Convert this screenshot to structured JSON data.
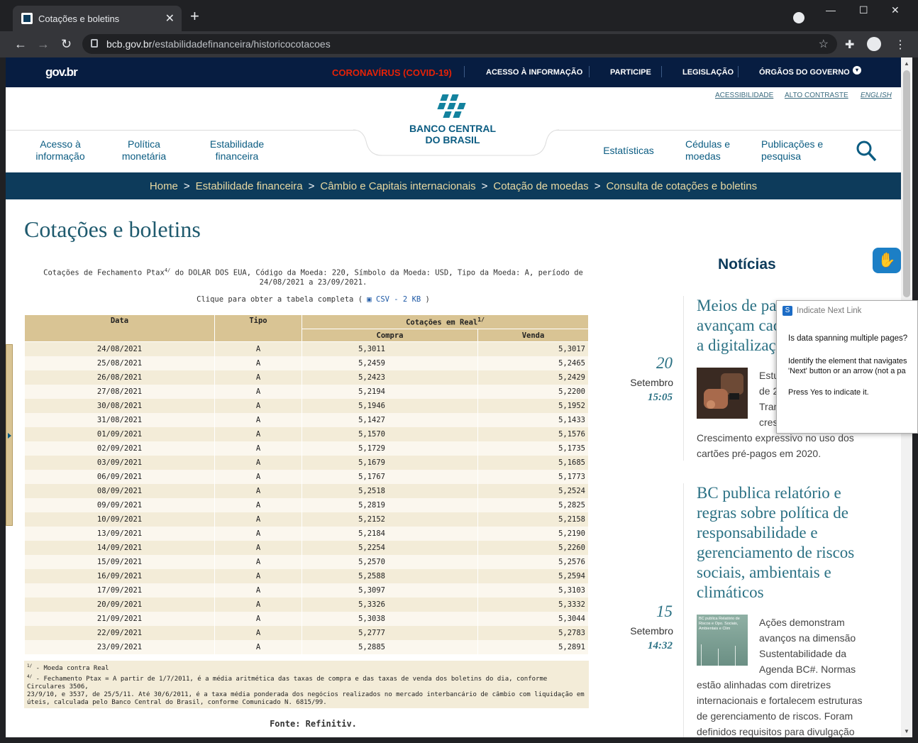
{
  "browser": {
    "tab_title": "Cotações e boletins",
    "url_host": "bcb.gov.br",
    "url_path": "/estabilidadefinanceira/historicocotacoes"
  },
  "gov_bar": {
    "logo": "gov.br",
    "covid": "CORONAVÍRUS (COVID-19)",
    "items": [
      "ACESSO À INFORMAÇÃO",
      "PARTICIPE",
      "LEGISLAÇÃO",
      "ÓRGÃOS DO GOVERNO"
    ]
  },
  "accessibility": [
    "ACESSIBILIDADE",
    "ALTO CONTRASTE",
    "ENGLISH"
  ],
  "bcb": {
    "line1": "BANCO CENTRAL",
    "line2": "DO BRASIL"
  },
  "menu": {
    "left": [
      [
        "Acesso à",
        "informação"
      ],
      [
        "Política",
        "monetária"
      ],
      [
        "Estabilidade",
        "financeira"
      ]
    ],
    "right": [
      [
        "Estatísticas",
        ""
      ],
      [
        "Cédulas e",
        "moedas"
      ],
      [
        "Publicações e",
        "pesquisa"
      ]
    ]
  },
  "breadcrumb": [
    "Home",
    "Estabilidade financeira",
    "Câmbio e Capitais internacionais",
    "Cotação de moedas",
    "Consulta de cotações e boletins"
  ],
  "page_title": "Cotações e boletins",
  "caption": {
    "pre": "Cotações de Fechamento Ptax",
    "sup": "4/",
    "post": " do DOLAR DOS EUA, Código da Moeda: 220, Símbolo da Moeda: USD, Tipo da Moeda: A, período de",
    "line2": "24/08/2021 a 23/09/2021."
  },
  "csv": {
    "pre": "Clique para obter a tabela completa ( ",
    "link": "CSV - 2 KB",
    "post": " )"
  },
  "table": {
    "headers": {
      "data": "Data",
      "tipo": "Tipo",
      "cotacoes": "Cotações em Real",
      "cotacoes_sup": "1/",
      "compra": "Compra",
      "venda": "Venda"
    },
    "rows": [
      [
        "24/08/2021",
        "A",
        "5,3011",
        "5,3017"
      ],
      [
        "25/08/2021",
        "A",
        "5,2459",
        "5,2465"
      ],
      [
        "26/08/2021",
        "A",
        "5,2423",
        "5,2429"
      ],
      [
        "27/08/2021",
        "A",
        "5,2194",
        "5,2200"
      ],
      [
        "30/08/2021",
        "A",
        "5,1946",
        "5,1952"
      ],
      [
        "31/08/2021",
        "A",
        "5,1427",
        "5,1433"
      ],
      [
        "01/09/2021",
        "A",
        "5,1570",
        "5,1576"
      ],
      [
        "02/09/2021",
        "A",
        "5,1729",
        "5,1735"
      ],
      [
        "03/09/2021",
        "A",
        "5,1679",
        "5,1685"
      ],
      [
        "06/09/2021",
        "A",
        "5,1767",
        "5,1773"
      ],
      [
        "08/09/2021",
        "A",
        "5,2518",
        "5,2524"
      ],
      [
        "09/09/2021",
        "A",
        "5,2819",
        "5,2825"
      ],
      [
        "10/09/2021",
        "A",
        "5,2152",
        "5,2158"
      ],
      [
        "13/09/2021",
        "A",
        "5,2184",
        "5,2190"
      ],
      [
        "14/09/2021",
        "A",
        "5,2254",
        "5,2260"
      ],
      [
        "15/09/2021",
        "A",
        "5,2570",
        "5,2576"
      ],
      [
        "16/09/2021",
        "A",
        "5,2588",
        "5,2594"
      ],
      [
        "17/09/2021",
        "A",
        "5,3097",
        "5,3103"
      ],
      [
        "20/09/2021",
        "A",
        "5,3326",
        "5,3332"
      ],
      [
        "21/09/2021",
        "A",
        "5,3038",
        "5,3044"
      ],
      [
        "22/09/2021",
        "A",
        "5,2777",
        "5,2783"
      ],
      [
        "23/09/2021",
        "A",
        "5,2885",
        "5,2891"
      ]
    ]
  },
  "notes": {
    "n1_sup": "1/",
    "n1": " - Moeda contra Real",
    "n4_sup": "4/",
    "n4_l1": " - Fechamento Ptax = A partir de 1/7/2011, é a média aritmética das taxas de compra e das taxas de venda dos boletins do dia, conforme Circulares 3506,",
    "n4_l2": "23/9/10, e 3537, de 25/5/11. Até 30/6/2011, é a taxa média ponderada dos negócios realizados no mercado interbancário de câmbio com liquidação em doi",
    "n4_l3": "úteis, calculada pelo Banco Central do Brasil, conforme Comunicado N. 6815/99."
  },
  "fonte": "Fonte: Refinitiv.",
  "news": {
    "heading": "Notícias",
    "items": [
      {
        "title": [
          "Meios de pa",
          "avançam cad",
          "a digitalizaç"
        ],
        "day": "20",
        "month": "Setembro",
        "time": "15:05",
        "text": [
          "Estu",
          "de 2",
          "Tran",
          "cres",
          "Crescimento expressivo no uso dos",
          "cartões pré-pagos em 2020."
        ]
      },
      {
        "title": [
          "BC publica relatório e",
          "regras sobre política de",
          "responsabilidade e",
          "gerenciamento de riscos",
          "sociais, ambientais e",
          "climáticos"
        ],
        "day": "15",
        "month": "Setembro",
        "time": "14:32",
        "thumb_caption": "BC publica Relatório de Riscos e Opo. Sociais, Ambientais e Clim",
        "text": [
          "Ações demonstram",
          "avanços na dimensão",
          "Sustentabilidade da",
          "Agenda BC#. Normas",
          "estão alinhadas com diretrizes",
          "internacionais e fortalecem estruturas",
          "de gerenciamento de riscos. Foram",
          "definidos requisitos para divulgação"
        ]
      }
    ]
  },
  "popup": {
    "title": "Indicate Next Link",
    "q": "Is data spanning multiple pages?",
    "l1": "Identify the element that navigates",
    "l2": "'Next' button or an arrow (not a pa",
    "l3": "Press Yes to indicate it."
  }
}
